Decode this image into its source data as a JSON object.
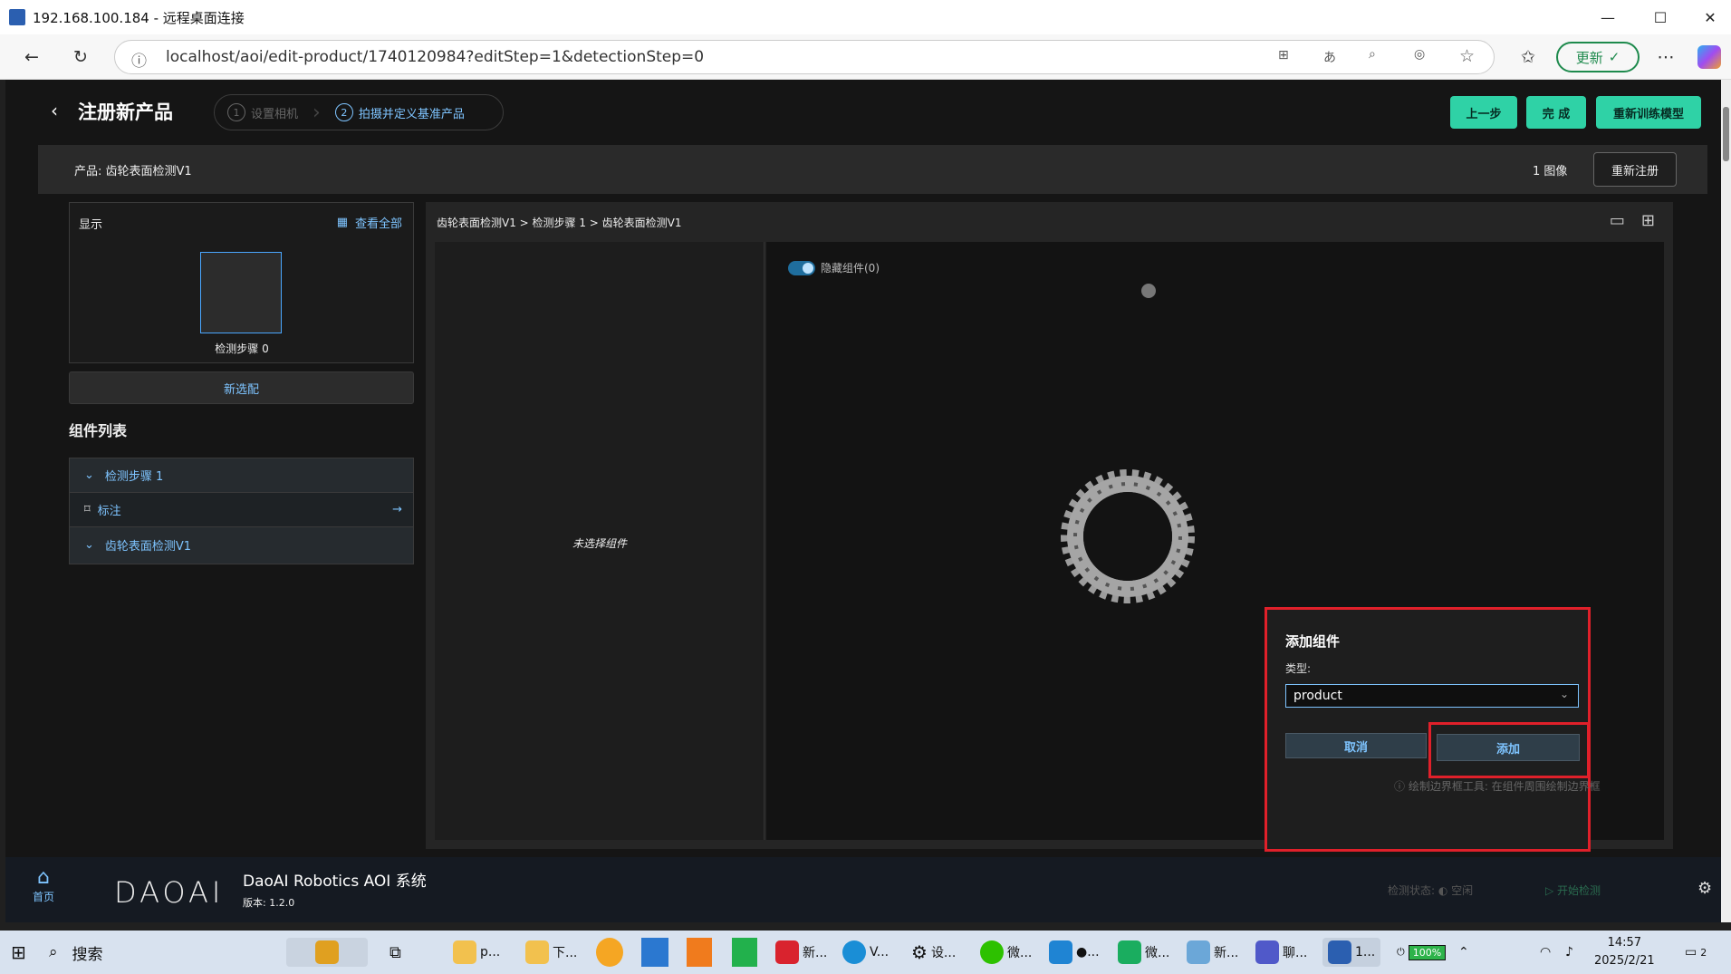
{
  "window": {
    "title": "192.168.100.184 - 远程桌面连接"
  },
  "browser": {
    "url": "localhost/aoi/edit-product/1740120984?editStep=1&detectionStep=0",
    "update_label": "更新"
  },
  "header": {
    "title": "注册新产品",
    "steps": [
      {
        "num": "1",
        "label": "设置相机"
      },
      {
        "num": "2",
        "label": "拍摄并定义基准产品"
      }
    ],
    "prev_label": "上一步",
    "done_label": "完 成",
    "retrain_label": "重新训练模型"
  },
  "product_bar": {
    "product_label": "产品: 齿轮表面检测V1",
    "image_count": "1 图像",
    "reregister_label": "重新注册"
  },
  "display_panel": {
    "title": "显示",
    "view_all": "查看全部",
    "thumb_label": "检测步骤 0"
  },
  "new_option_label": "新选配",
  "component_list": {
    "title": "组件列表",
    "rows": [
      {
        "label": "检测步骤 1"
      },
      {
        "label": "标注"
      },
      {
        "label": "齿轮表面检测V1"
      }
    ]
  },
  "main": {
    "breadcrumb": "齿轮表面检测V1 > 检测步骤 1 > 齿轮表面检测V1",
    "no_component": "未选择组件",
    "hide_toggle": "隐藏组件(0)"
  },
  "dialog": {
    "title": "添加组件",
    "type_label": "类型:",
    "type_value": "product",
    "cancel_label": "取消",
    "add_label": "添加",
    "hint": "ⓘ 绘制边界框工具: 在组件周围绘制边界框"
  },
  "footer": {
    "home_label": "首页",
    "logo": "DAOAI",
    "app_name": "DaoAI Robotics AOI 系统",
    "version": "版本: 1.2.0",
    "status": "检测状态: ◐ 空闲",
    "start_label": "▷ 开始检测"
  },
  "taskbar": {
    "search": "搜索",
    "items": [
      "p...",
      "下...",
      "新...",
      "V...",
      "设...",
      "微...",
      "●...",
      "微...",
      "新...",
      "聊...",
      "1..."
    ],
    "battery": "100%",
    "time": "14:57",
    "date": "2025/2/21",
    "notify_count": "2"
  }
}
